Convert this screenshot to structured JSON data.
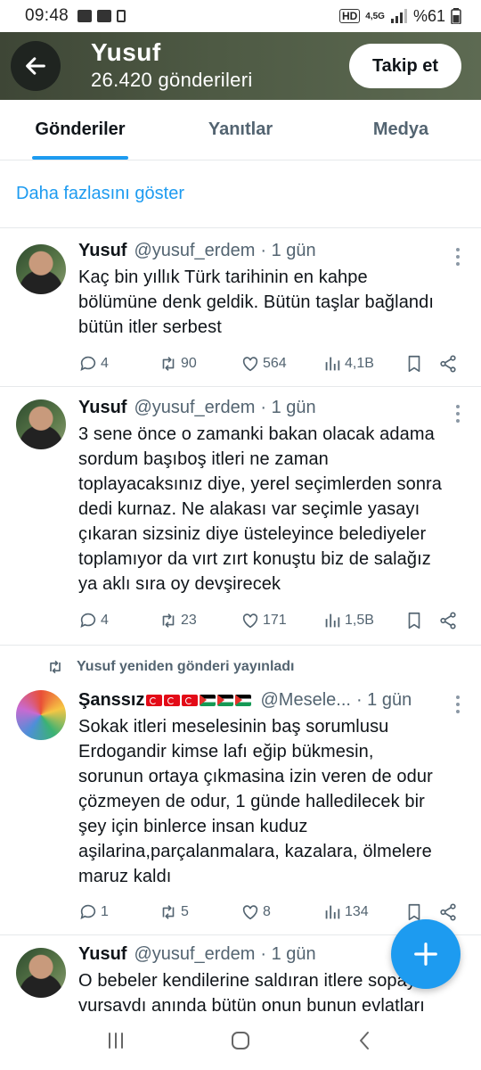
{
  "status_bar": {
    "time": "09:48",
    "network": "4,5G",
    "battery": "%61"
  },
  "header": {
    "name": "Yusuf",
    "post_count": "26.420 gönderileri",
    "follow_label": "Takip et"
  },
  "tabs": [
    {
      "label": "Gönderiler",
      "active": true
    },
    {
      "label": "Yanıtlar",
      "active": false
    },
    {
      "label": "Medya",
      "active": false
    }
  ],
  "show_more": "Daha fazlasını göster",
  "posts": [
    {
      "name": "Yusuf",
      "handle": "@yusuf_erdem",
      "time": "· 1 gün",
      "text": "Kaç bin yıllık Türk tarihinin en kahpe\nbölümüne denk geldik. Bütün taşlar bağlandı\nbütün itler serbest",
      "replies": "4",
      "reposts": "90",
      "likes": "564",
      "views": "4,1B"
    },
    {
      "name": "Yusuf",
      "handle": "@yusuf_erdem",
      "time": "· 1 gün",
      "text": "3 sene önce o zamanki bakan olacak adama\nsordum başıboş itleri ne zaman\ntoplayacaksınız diye, yerel seçimlerden sonra\ndedi kurnaz. Ne alakası var seçimle yasayı\nçıkaran sizsiniz diye üsteleyince belediyeler\ntoplamıyor da vırt zırt konuştu biz de salağız\nya aklı sıra oy devşirecek",
      "replies": "4",
      "reposts": "23",
      "likes": "171",
      "views": "1,5B"
    },
    {
      "repost_note": "Yusuf yeniden gönderi yayınladı",
      "name": "Şanssız",
      "handle": "@Mesele...",
      "time": "· 1 gün",
      "text": "Sokak itleri meselesinin baş sorumlusu\nErdogandir kimse lafı eğip bükmesin,\nsorunun ortaya çıkmasina izin veren de odur\nçözmeyen de odur, 1 günde halledilecek bir\nşey için binlerce insan kuduz\naşilarina,parçalanmalara, kazalara, ölmelere\nmaruz kaldı",
      "replies": "1",
      "reposts": "5",
      "likes": "8",
      "views": "134"
    },
    {
      "name": "Yusuf",
      "handle": "@yusuf_erdem",
      "time": "· 1 gün",
      "text": "O bebeler kendilerine saldıran itlere sopayla\nvursaydı anında bütün onun bunun evlatları"
    }
  ],
  "colors": {
    "accent": "#1d9bf0",
    "text": "#0f1419",
    "muted": "#536471"
  }
}
